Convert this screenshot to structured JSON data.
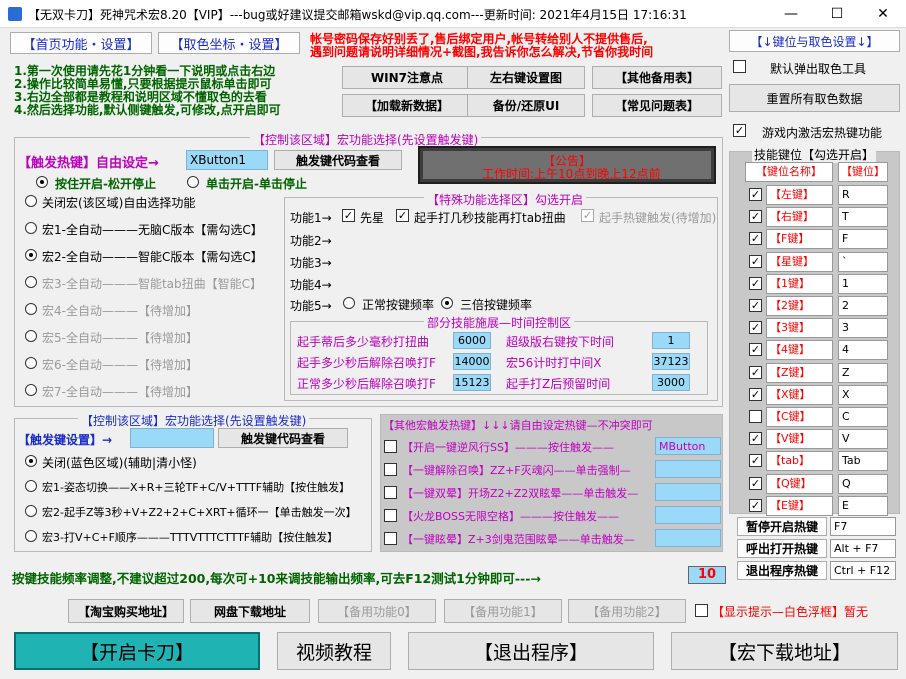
{
  "window": {
    "title": "【无双卡刀】死神咒术宏8.20【VIP】---bug或好建议提交邮箱wskd@vip.qq.com---更新时间: 2021年4月15日 17:16:31",
    "min": "—",
    "max": "☐",
    "close": "✕"
  },
  "tabs": {
    "home": "【首页功能・设置】",
    "color": "【取色坐标・设置】"
  },
  "notice_red": {
    "line1": "帐号密码保存好别丢了,售后绑定用户,帐号转给别人不提供售后,",
    "line2": "遇到问题请说明详细情况+截图,我告诉你怎么解决,节省你我时间"
  },
  "topright": {
    "down_btn": "【↓键位与取色设置↓】",
    "auto_pop": "默认弹出取色工具",
    "reset": "重置所有取色数据",
    "game_activate": "游戏内激活宏热键功能"
  },
  "steps": [
    "1.第一次使用请先花1分钟看一下说明或点击右边",
    "2.操作比较简单易懂,只要根据提示鼠标单击即可",
    "3.右边全部都是教程和说明区域不懂取色的去看",
    "4.然后选择功能,默认侧键触发,可修改,点开启即可"
  ],
  "topbtns": {
    "win7": "WIN7注意点",
    "lr": "左右键设置图",
    "other": "【其他备用表】",
    "load": "【加载新数据】",
    "backup": "备份/还原UI",
    "faq": "【常见问题表】"
  },
  "main": {
    "legend": "【控制该区域】宏功能选择(先设置触发键)",
    "hotkey_label": "【触发热键】自由设定→",
    "hotkey_value": "XButton1",
    "hotkey_btn": "触发键代码查看",
    "press_mode": "按住开启-松开停止",
    "click_mode": "单击开启-单击停止",
    "announcement_title": "【公告】",
    "announcement_text": "工作时间:上午10点到晚上12点前",
    "macros": [
      "关闭宏(该区域)自由选择功能",
      "宏1-全自动———无脑C版本【需勾选C】",
      "宏2-全自动———智能C版本【需勾选C】",
      "宏3-全自动———智能tab扭曲【智能C】",
      "宏4-全自动———【待增加】",
      "宏5-全自动———【待增加】",
      "宏6-全自动———【待增加】",
      "宏7-全自动———【待增加】"
    ],
    "special": {
      "legend": "【特殊功能选择区】勾选开启",
      "f1": "功能1→",
      "f1_a": "先星",
      "f1_b": "起手打几秒技能再打tab扭曲",
      "f1_c": "起手热键触发(待增加)",
      "f2": "功能2→",
      "f3": "功能3→",
      "f4": "功能4→",
      "f5": "功能5→",
      "f5_a": "正常按键频率",
      "f5_b": "三倍按键频率"
    },
    "timing": {
      "legend": "部分技能施展—时间控制区",
      "r1": "起手蒂后多少毫秒打扭曲",
      "v1": "6000",
      "r1b": "超级版右键按下时间",
      "v1b": "1",
      "r2": "起手多少秒后解除召唤打F",
      "v2": "14000",
      "r2b": "宏56计时打中间X",
      "v2b": "37123",
      "r3": "正常多少秒后解除召唤打F",
      "v3": "15123",
      "r3b": "起手打Z后预留时间",
      "v3b": "3000"
    }
  },
  "sub": {
    "legend": "【控制该区域】宏功能选择(先设置触发键)",
    "hotkey_label": "【触发键设置】→",
    "hotkey_btn": "触发键代码查看",
    "items": [
      "关闭(蓝色区域)(辅助|清小怪)",
      "宏1-姿态切换——X+R+三轮TF+C/V+TTTF辅助【按住触发】",
      "宏2-起手Z等3秒+V+Z2+2+C+XRT+循环一【单击触发一次】",
      "宏3-打V+C+F顺序———TTTVTTTCTTTF辅助【按住触发】"
    ]
  },
  "other": {
    "legend": "【其他宏触发热键】↓↓↓请自由设定热键—不冲突即可",
    "items": [
      {
        "label": "【开启一键逆风行SS】———按住触发——",
        "value": "MButton"
      },
      {
        "label": "【一键解除召唤】ZZ+F灭魂闪——单击强制—",
        "value": ""
      },
      {
        "label": "【一键双晕】开场Z2+Z2双眩晕——单击触发—",
        "value": ""
      },
      {
        "label": "【火龙BOSS无限空格】———按住触发——",
        "value": ""
      },
      {
        "label": "【一键眩晕】Z+3剑鬼范围眩晕——单击触发—",
        "value": ""
      }
    ]
  },
  "keys": {
    "legend": "技能键位【勾选开启】",
    "col1": "【键位名称】",
    "col2": "【键位】",
    "rows": [
      {
        "name": "【左键】",
        "key": "R",
        "checked": true
      },
      {
        "name": "【右键】",
        "key": "T",
        "checked": true
      },
      {
        "name": "【F键】",
        "key": "F",
        "checked": true
      },
      {
        "name": "【星键】",
        "key": "`",
        "checked": true
      },
      {
        "name": "【1键】",
        "key": "1",
        "checked": true
      },
      {
        "name": "【2键】",
        "key": "2",
        "checked": true
      },
      {
        "name": "【3键】",
        "key": "3",
        "checked": true
      },
      {
        "name": "【4键】",
        "key": "4",
        "checked": true
      },
      {
        "name": "【Z键】",
        "key": "Z",
        "checked": true
      },
      {
        "name": "【X键】",
        "key": "X",
        "checked": true
      },
      {
        "name": "【C键】",
        "key": "C",
        "checked": false
      },
      {
        "name": "【V键】",
        "key": "V",
        "checked": true
      },
      {
        "name": "【tab】",
        "key": "Tab",
        "checked": true
      },
      {
        "name": "【Q键】",
        "key": "Q",
        "checked": true
      },
      {
        "name": "【E键】",
        "key": "E",
        "checked": true
      }
    ],
    "pause_label": "暂停开启热键",
    "pause_value": "F7",
    "show_label": "呼出打开热键",
    "show_value": "Alt + F7",
    "exit_label": "退出程序热键",
    "exit_value": "Ctrl + F12"
  },
  "freq": {
    "text": "按键技能频率调整,不建议超过200,每次可+10来调技能输出频率,可去F12测试1分钟即可---→",
    "value": "10"
  },
  "bottom": {
    "taobao": "【淘宝购买地址】",
    "netdisk": "网盘下载地址",
    "spare0": "【备用功能0】",
    "spare1": "【备用功能1】",
    "spare2": "【备用功能2】",
    "tip": "【显示提示—白色浮框】暂无",
    "start": "【开启卡刀】",
    "video": "视频教程",
    "exit": "【退出程序】",
    "download": "【宏下载地址】"
  }
}
